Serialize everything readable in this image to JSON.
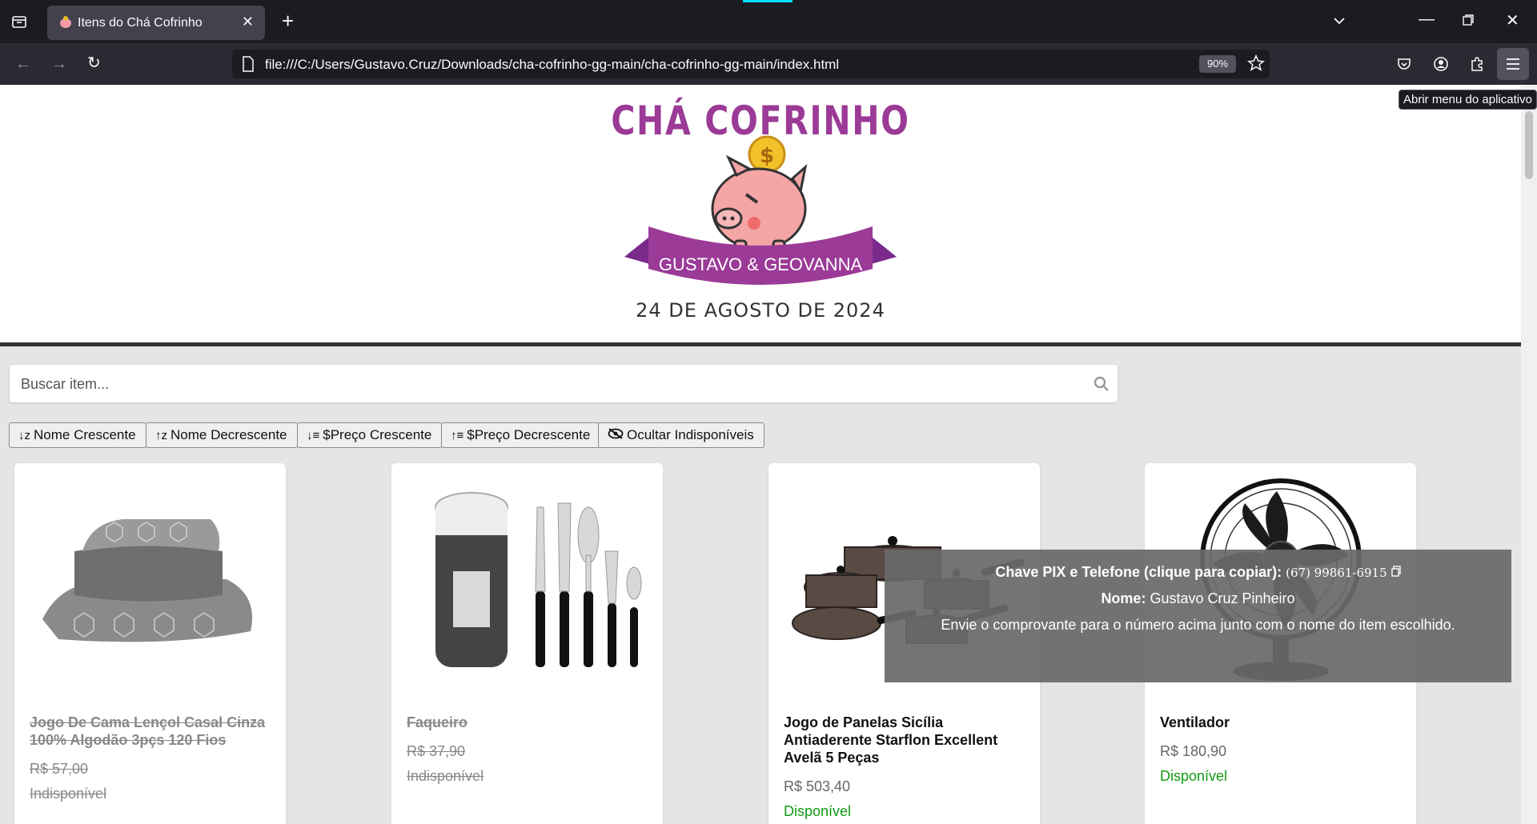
{
  "browser": {
    "tab_title": "Itens do Chá Cofrinho",
    "url": "file:///C:/Users/Gustavo.Cruz/Downloads/cha-cofrinho-gg-main/cha-cofrinho-gg-main/index.html",
    "zoom": "90%",
    "menu_tooltip": "Abrir menu do aplicativo"
  },
  "header": {
    "logo_title": "CHÁ COFRINHO",
    "banner": "GUSTAVO & GEOVANNA",
    "date": "24 DE AGOSTO DE 2024"
  },
  "search": {
    "placeholder": "Buscar item..."
  },
  "sort_buttons": [
    {
      "label": "Nome Crescente",
      "icon": "sort-alpha-down-icon"
    },
    {
      "label": "Nome Decrescente",
      "icon": "sort-alpha-up-icon"
    },
    {
      "label": "$Preço Crescente",
      "icon": "sort-amount-up-icon"
    },
    {
      "label": "$Preço Decrescente",
      "icon": "sort-amount-down-icon"
    },
    {
      "label": "Ocultar Indisponíveis",
      "icon": "eye-slash-icon"
    }
  ],
  "products": [
    {
      "name": "Jogo De Cama Lençol Casal Cinza 100% Algodão 3pçs 120 Fios",
      "price": "R$ 57,00",
      "status": "Indisponível",
      "available": false,
      "image": "bed-sheet-set"
    },
    {
      "name": "Faqueiro",
      "price": "R$ 37,90",
      "status": "Indisponível",
      "available": false,
      "image": "cutlery-set"
    },
    {
      "name": "Jogo de Panelas Sicília Antiaderente Starflon Excellent Avelã 5 Peças",
      "price": "R$ 503,40",
      "status": "Disponível",
      "available": true,
      "image": "cookware-set"
    },
    {
      "name": "Ventilador",
      "price": "R$ 180,90",
      "status": "Disponível",
      "available": true,
      "image": "fan"
    }
  ],
  "pix": {
    "label": "Chave PIX e Telefone (clique para copiar):",
    "phone": "(67) 99861-6915",
    "name_label": "Nome:",
    "name": "Gustavo Cruz Pinheiro",
    "note": "Envie o comprovante para o número acima junto com o nome do item escolhido."
  },
  "colors": {
    "brand": "#9b3a97",
    "available": "#129a12"
  }
}
